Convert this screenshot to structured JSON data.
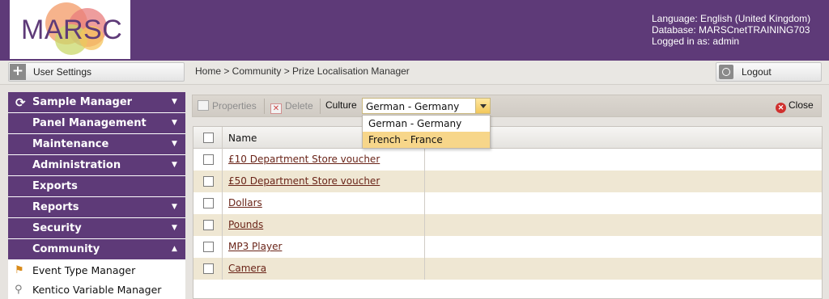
{
  "header": {
    "logo_text": "MARSC",
    "user_info": {
      "language": "Language: English (United Kingdom)",
      "database": "Database: MARSCnetTRAINING703",
      "logged_in": "Logged in as: admin"
    }
  },
  "subbar": {
    "user_settings_label": "User Settings",
    "breadcrumb": "Home > Community > Prize Localisation Manager",
    "logout_label": "Logout"
  },
  "sidebar": {
    "items": [
      {
        "label": "Sample Manager",
        "expanded": false
      },
      {
        "label": "Panel Management",
        "expanded": false
      },
      {
        "label": "Maintenance",
        "expanded": false
      },
      {
        "label": "Administration",
        "expanded": false
      },
      {
        "label": "Exports"
      },
      {
        "label": "Reports",
        "expanded": false
      },
      {
        "label": "Security",
        "expanded": false
      },
      {
        "label": "Community",
        "expanded": true
      }
    ],
    "sub_items": [
      {
        "label": "Event Type Manager",
        "icon": "flag-icon"
      },
      {
        "label": "Kentico Variable Manager",
        "icon": "paperclip-icon"
      }
    ]
  },
  "toolbar": {
    "properties_label": "Properties",
    "delete_label": "Delete",
    "culture_label": "Culture",
    "culture_value": "German - Germany",
    "close_label": "Close"
  },
  "culture_dropdown": {
    "options": [
      "German - Germany",
      "French - France"
    ],
    "highlighted": "French - France"
  },
  "grid": {
    "columns": [
      "Name"
    ],
    "rows": [
      "£10 Department Store voucher",
      "£50 Department Store voucher",
      "Dollars",
      "Pounds",
      "MP3 Player",
      "Camera"
    ]
  },
  "colors": {
    "brand_purple": "#5e3a78",
    "row_alt": "#efe7d3",
    "link": "#6a2418",
    "dropdown_highlight": "#f7d68a"
  }
}
